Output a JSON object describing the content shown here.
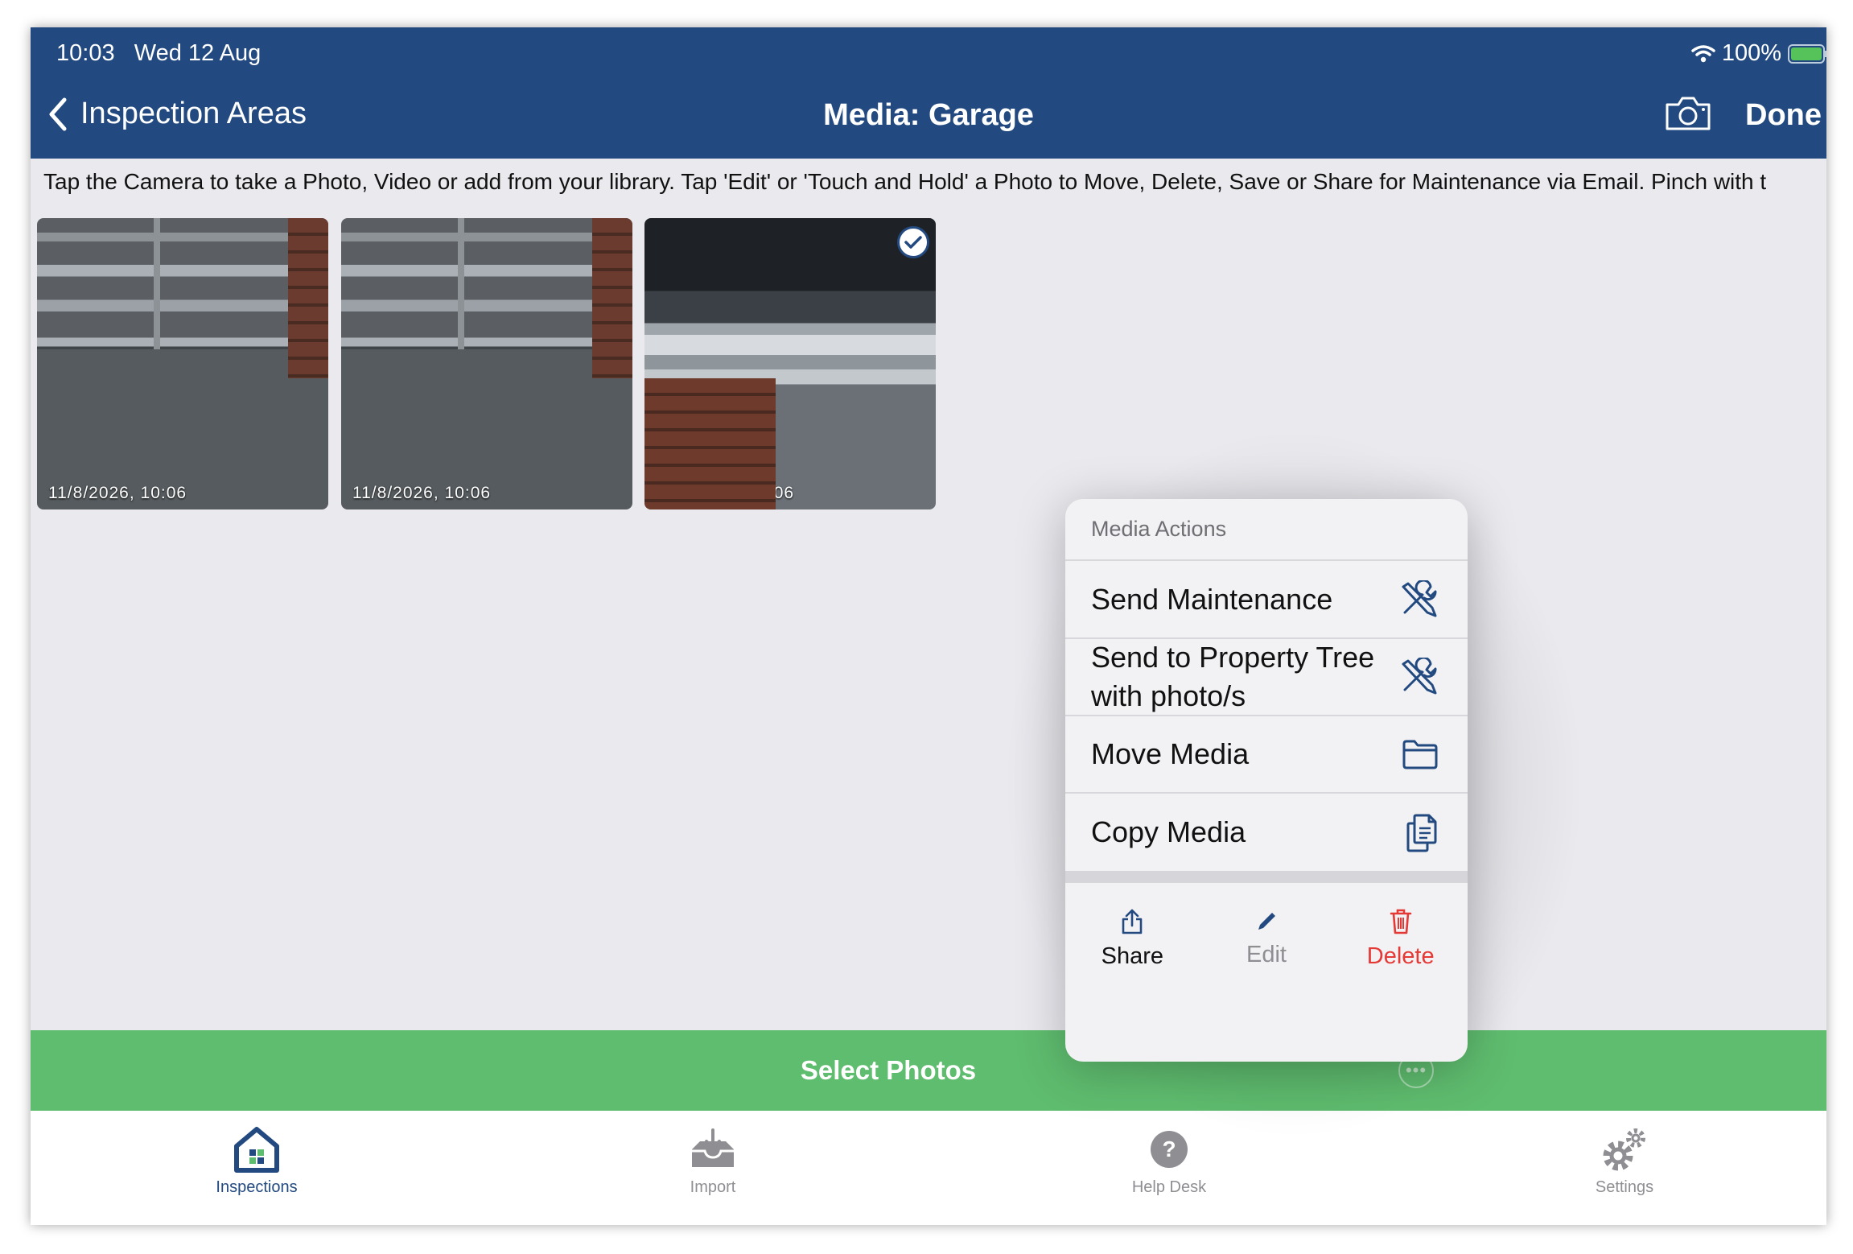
{
  "status_bar": {
    "time": "10:03",
    "date": "Wed 12 Aug",
    "battery": "100%"
  },
  "nav": {
    "back_label": "Inspection Areas",
    "title": "Media: Garage",
    "done_label": "Done"
  },
  "instructions": "Tap the Camera to take a Photo, Video or add from your library. Tap 'Edit' or 'Touch and Hold' a Photo to Move, Delete, Save or Share for Maintenance via Email. Pinch with t",
  "photos": [
    {
      "timestamp": "11/8/2026, 10:06",
      "selected": true
    },
    {
      "timestamp": "11/8/2026, 10:06",
      "selected": true
    },
    {
      "timestamp": "11/8/2026, 10:06",
      "selected": true
    }
  ],
  "menu": {
    "header": "Media Actions",
    "items": [
      {
        "label": "Send Maintenance",
        "icon": "tools-icon"
      },
      {
        "label_line1": "Send to Property Tree",
        "label_line2": "with photo/s",
        "icon": "tools-icon"
      },
      {
        "label": "Move Media",
        "icon": "folder-icon"
      },
      {
        "label": "Copy Media",
        "icon": "copy-icon"
      }
    ],
    "actions": [
      {
        "label": "Share",
        "icon": "share-icon"
      },
      {
        "label": "Edit",
        "icon": "pencil-icon"
      },
      {
        "label": "Delete",
        "icon": "trash-icon"
      }
    ]
  },
  "select_bar": {
    "label": "Select Photos"
  },
  "tabs": [
    {
      "label": "Inspections",
      "icon": "house-icon",
      "active": true
    },
    {
      "label": "Import",
      "icon": "import-icon"
    },
    {
      "label": "Help Desk",
      "icon": "help-icon"
    },
    {
      "label": "Settings",
      "icon": "gear-icon"
    }
  ],
  "colors": {
    "nav": "#234a80",
    "green": "#5fbd6f",
    "destructive": "#e53935"
  }
}
